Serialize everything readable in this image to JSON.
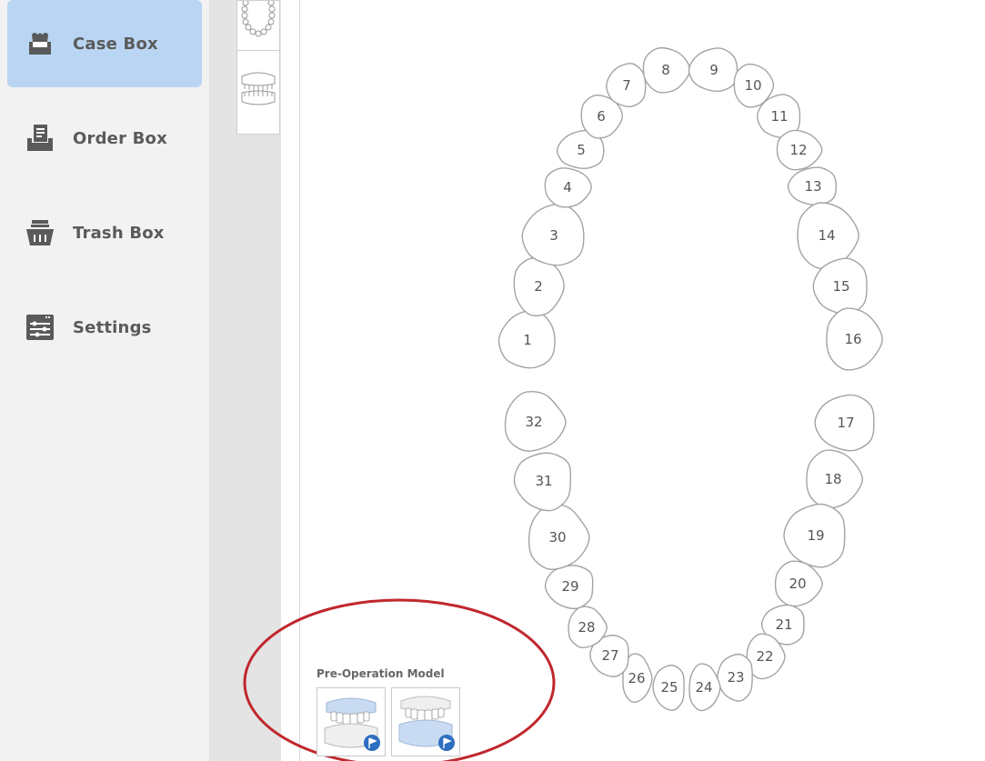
{
  "sidebar": {
    "items": [
      {
        "label": "Case Box",
        "icon": "case-box-icon",
        "active": true
      },
      {
        "label": "Order Box",
        "icon": "order-box-icon",
        "active": false
      },
      {
        "label": "Trash Box",
        "icon": "trash-box-icon",
        "active": false
      },
      {
        "label": "Settings",
        "icon": "settings-icon",
        "active": false
      }
    ]
  },
  "colors": {
    "sidebar_bg": "#f2f2f2",
    "active_bg": "#b9d5f3",
    "tooth_stroke": "#a3a3a3",
    "annotation_red": "#c0272d",
    "accent_blue": "#2e6fc0",
    "gum_blue": "#c9dbf2"
  },
  "tooth_chart": {
    "upper": [
      "1",
      "2",
      "3",
      "4",
      "5",
      "6",
      "7",
      "8",
      "9",
      "10",
      "11",
      "12",
      "13",
      "14",
      "15",
      "16"
    ],
    "lower": [
      "17",
      "18",
      "19",
      "20",
      "21",
      "22",
      "23",
      "24",
      "25",
      "26",
      "27",
      "28",
      "29",
      "30",
      "31",
      "32"
    ]
  },
  "preop": {
    "title": "Pre-Operation Model",
    "models": [
      {
        "name": "upper-jaw-model",
        "icon": "upper-model-icon",
        "badge": "flag-icon"
      },
      {
        "name": "lower-jaw-model",
        "icon": "lower-model-icon",
        "badge": "flag-icon"
      }
    ]
  }
}
